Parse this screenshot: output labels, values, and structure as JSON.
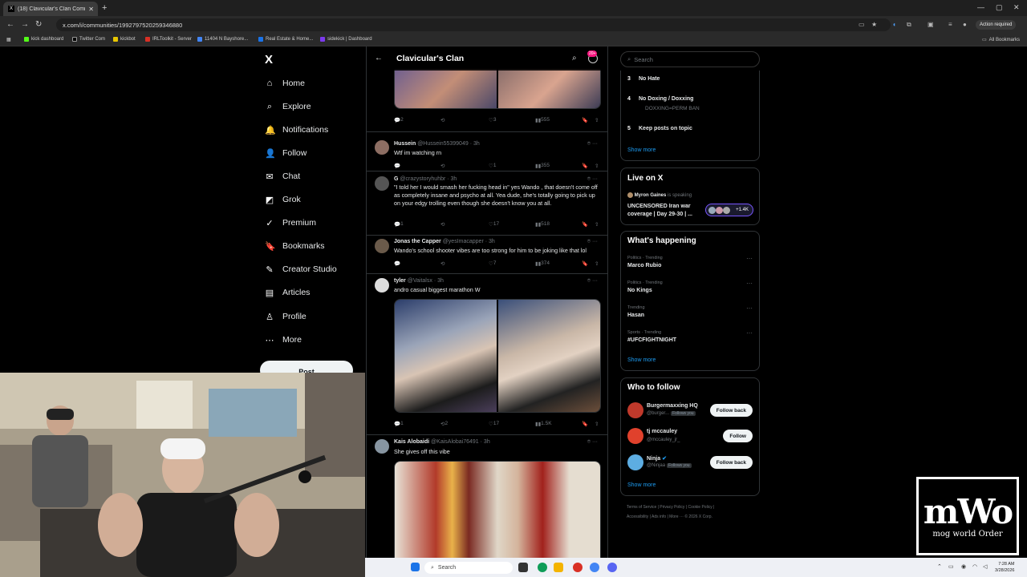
{
  "browser": {
    "tab_title": "(18) Clavicular's Clan Communi",
    "url": "x.com/i/communities/1992797520259346880",
    "action_required": "Action required",
    "all_bookmarks": "All Bookmarks",
    "bookmarks": [
      {
        "label": "kick dashboard",
        "color": "#53fc18"
      },
      {
        "label": "Twitter Com",
        "color": "#000000"
      },
      {
        "label": "kickbot",
        "color": "#e8c600"
      },
      {
        "label": "IRLToolkit - Server",
        "color": "#d93025"
      },
      {
        "label": "11404 N Bayshore...",
        "color": "#4285f4"
      },
      {
        "label": "Real Estate & Home...",
        "color": "#1a73e8"
      },
      {
        "label": "sidekick | Dashboard",
        "color": "#7c3aed"
      }
    ]
  },
  "nav": {
    "logo": "X",
    "items": [
      {
        "label": "Home",
        "icon": "⌂"
      },
      {
        "label": "Explore",
        "icon": "⌕"
      },
      {
        "label": "Notifications",
        "icon": "🔔"
      },
      {
        "label": "Follow",
        "icon": "👤"
      },
      {
        "label": "Chat",
        "icon": "✉"
      },
      {
        "label": "Grok",
        "icon": "◩"
      },
      {
        "label": "Premium",
        "icon": "✓"
      },
      {
        "label": "Bookmarks",
        "icon": "🔖"
      },
      {
        "label": "Creator Studio",
        "icon": "✎"
      },
      {
        "label": "Articles",
        "icon": "▤"
      },
      {
        "label": "Profile",
        "icon": "♙"
      },
      {
        "label": "More",
        "icon": "⋯"
      }
    ],
    "post_label": "Post"
  },
  "header": {
    "title": "Clavicular's Clan",
    "badge": "20+"
  },
  "tweets": [
    {
      "name": "",
      "handle": "",
      "time": "",
      "text": "",
      "actions": {
        "replies": "2",
        "reposts": "",
        "likes": "3",
        "views": "555"
      }
    },
    {
      "name": "Hussein",
      "handle": "@Hussein55399049",
      "time": "· 3h",
      "text": "Wtf im watching rn",
      "actions": {
        "replies": "",
        "reposts": "",
        "likes": "1",
        "views": "355"
      }
    },
    {
      "name": "G",
      "handle": "@crazystoryhuhbr",
      "time": "· 3h",
      "text": "\"I told her I would smash her fucking head in\" yes Wando , that doesn't come off as completely insane and psycho at all. Yea dude, she's totally going to pick up on your edgy trolling even though she doesn't know you at all.",
      "actions": {
        "replies": "1",
        "reposts": "",
        "likes": "17",
        "views": "518"
      }
    },
    {
      "name": "Jonas the Capper",
      "handle": "@yesImacapper",
      "time": "· 3h",
      "text": "Wando's school shooter vibes are too strong for him to be joking like that lol",
      "actions": {
        "replies": "",
        "reposts": "",
        "likes": "7",
        "views": "374"
      }
    },
    {
      "name": "tyler",
      "handle": "@Vaitalsx",
      "time": "· 3h",
      "text": "andro casual biggest marathon W",
      "actions": {
        "replies": "1",
        "reposts": "2",
        "likes": "17",
        "views": "1.5K"
      }
    },
    {
      "name": "Kais Alobaidi",
      "handle": "@KaisAlobai76491",
      "time": "· 3h",
      "text": "She gives off this vibe",
      "actions": {
        "replies": "",
        "reposts": "",
        "likes": "",
        "views": ""
      }
    }
  ],
  "right": {
    "search_placeholder": "Search",
    "rules": [
      {
        "num": "3",
        "title": "No Hate",
        "sub": ""
      },
      {
        "num": "4",
        "title": "No Doxing / Doxxing",
        "sub": "DOXXING=PERM BAN"
      },
      {
        "num": "5",
        "title": "Keep posts on topic",
        "sub": ""
      }
    ],
    "show_more": "Show more",
    "live": {
      "title": "Live on X",
      "host": "Myron Gaines",
      "status": "is speaking",
      "line1": "UNCENSORED Iran war",
      "line2": "coverage | Day 29-30 | ...",
      "count": "+1.4K"
    },
    "happening": {
      "title": "What's happening",
      "items": [
        {
          "sub": "Politics · Trending",
          "name": "Marco Rubio"
        },
        {
          "sub": "Politics · Trending",
          "name": "No Kings"
        },
        {
          "sub": "Trending",
          "name": "Hasan"
        },
        {
          "sub": "Sports · Trending",
          "name": "#UFCFIGHTNIGHT"
        }
      ]
    },
    "who": {
      "title": "Who to follow",
      "items": [
        {
          "name": "Burgermaxxing HQ",
          "handle": "@burger...",
          "follows_you": "Follows you",
          "button": "Follow back",
          "color": "#c0392b"
        },
        {
          "name": "tj mccauley",
          "handle": "@mccauley_jr_",
          "follows_you": "",
          "button": "Follow",
          "color": "#e0412c"
        },
        {
          "name": "Ninja",
          "handle": "@Ninjaa",
          "follows_you": "Follows you",
          "button": "Follow back",
          "color": "#5dade2"
        }
      ]
    },
    "footer1": "Terms of Service  |  Privacy Policy  |  Cookie Policy  |",
    "footer2": "Accessibility  |  Ads info  |  More ···  © 2026 X Corp."
  },
  "overlay": {
    "logo_big": "mWo",
    "logo_small": "mog world Order"
  },
  "taskbar": {
    "search_placeholder": "Search",
    "time": "7:28 AM",
    "date": "3/28/2026"
  }
}
